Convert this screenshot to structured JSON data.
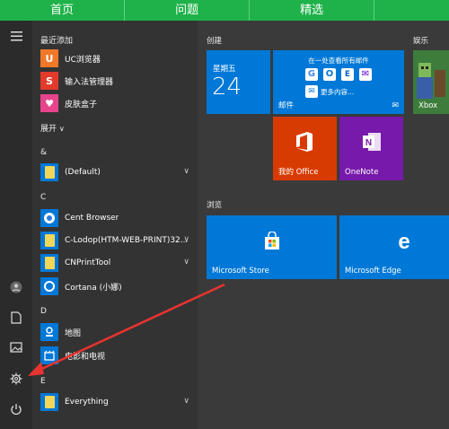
{
  "topnav": [
    "首页",
    "问题",
    "精选"
  ],
  "applist": {
    "recent_header": "最近添加",
    "recent": [
      {
        "label": "UC浏览器",
        "icon": "uc-browser-icon",
        "color": "#f07828"
      },
      {
        "label": "输入法管理器",
        "icon": "sogou-input-icon",
        "color": "#e23a2b"
      },
      {
        "label": "皮肤盒子",
        "icon": "skin-box-icon",
        "color": "#e6458c"
      }
    ],
    "expand_label": "展开",
    "groups": [
      {
        "letter": "&",
        "items": [
          {
            "label": "(Default)",
            "type": "folder",
            "chevron": true
          }
        ]
      },
      {
        "letter": "C",
        "items": [
          {
            "label": "Cent Browser",
            "type": "app",
            "icon": "cent-browser-icon",
            "chevron": false
          },
          {
            "label": "C-Lodop(HTM-WEB-PRINT)32...",
            "type": "folder",
            "chevron": true
          },
          {
            "label": "CNPrintTool",
            "type": "folder",
            "chevron": true
          },
          {
            "label": "Cortana (小娜)",
            "type": "app",
            "icon": "cortana-icon",
            "chevron": false
          }
        ]
      },
      {
        "letter": "D",
        "items": [
          {
            "label": "地图",
            "type": "app",
            "icon": "maps-icon",
            "chevron": false
          },
          {
            "label": "电影和电视",
            "type": "app",
            "icon": "movies-tv-icon",
            "chevron": false
          }
        ]
      },
      {
        "letter": "E",
        "items": [
          {
            "label": "Everything",
            "type": "folder",
            "chevron": true
          }
        ]
      }
    ]
  },
  "tiles": {
    "create_title": "创建",
    "browse_title": "浏览",
    "entertainment_title": "娱乐",
    "calendar": {
      "weekday": "星期五",
      "day": "24"
    },
    "mail": {
      "header": "在一处查看所有邮件",
      "more": "更多内容...",
      "label": "邮件"
    },
    "office": {
      "label": "我的 Office"
    },
    "onenote": {
      "label": "OneNote"
    },
    "store": {
      "label": "Microsoft Store"
    },
    "edge": {
      "label": "Microsoft Edge"
    },
    "xbox": {
      "label": "Xbox"
    }
  },
  "colors": {
    "tile_blue": "#0078d7",
    "office_orange": "#d83b01",
    "onenote_purple": "#7719aa",
    "nav_green": "#1fb24a",
    "arrow_red": "#e8332f"
  }
}
